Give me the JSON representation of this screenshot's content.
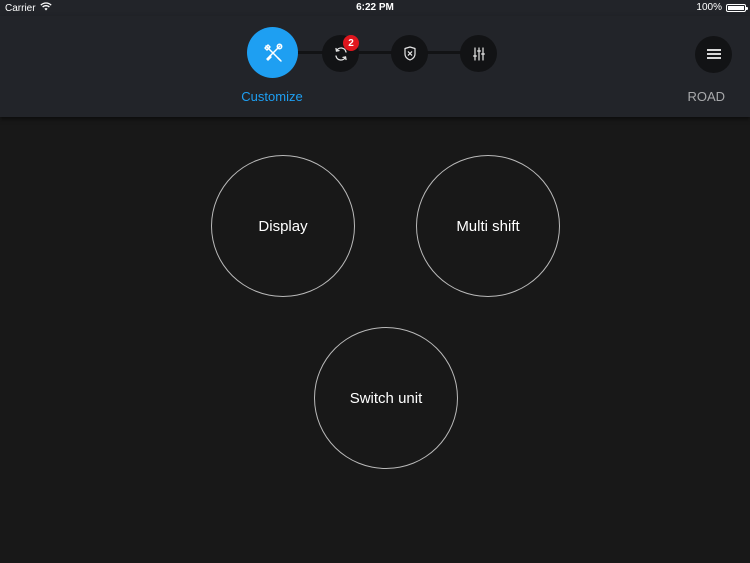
{
  "status_bar": {
    "carrier": "Carrier",
    "time": "6:22 PM",
    "battery": "100%",
    "battery_level": 1.0
  },
  "header": {
    "steps": [
      {
        "icon": "tools-icon",
        "label": "Customize",
        "active": true
      },
      {
        "icon": "sync-icon",
        "badge": "2"
      },
      {
        "icon": "shield-icon"
      },
      {
        "icon": "sliders-icon"
      }
    ],
    "mode_label": "ROAD",
    "menu_icon": "menu-lines-icon"
  },
  "main": {
    "buttons": [
      {
        "label": "Display"
      },
      {
        "label": "Multi shift"
      },
      {
        "label": "Switch unit"
      }
    ]
  },
  "colors": {
    "accent": "#1e9ff2",
    "badge": "#e0161e",
    "background": "#181818",
    "header": "#222429"
  }
}
